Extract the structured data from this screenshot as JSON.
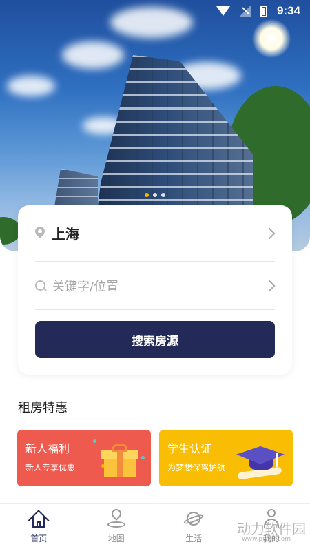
{
  "status_bar": {
    "time": "9:34"
  },
  "hero": {
    "slides_total": 3,
    "active_slide": 1
  },
  "search": {
    "city": "上海",
    "keyword_placeholder": "关键字/位置",
    "button_label": "搜索房源"
  },
  "section": {
    "title": "租房特惠",
    "promos": [
      {
        "title": "新人福利",
        "subtitle": "新人专享优惠",
        "color": "#ef5a4e",
        "icon": "gift-icon"
      },
      {
        "title": "学生认证",
        "subtitle": "为梦想保驾护航",
        "color": "#f9bd04",
        "icon": "graduation-cap-icon"
      }
    ]
  },
  "nav": {
    "items": [
      {
        "label": "首页",
        "icon": "home-icon",
        "active": true
      },
      {
        "label": "地图",
        "icon": "map-icon",
        "active": false
      },
      {
        "label": "生活",
        "icon": "planet-icon",
        "active": false
      },
      {
        "label": "我的",
        "icon": "user-icon",
        "active": false
      }
    ]
  },
  "watermark": {
    "text": "动力软件园",
    "url": "www.pw88.com"
  },
  "colors": {
    "primary": "#232a57",
    "accent_dot": "#f5b800"
  }
}
